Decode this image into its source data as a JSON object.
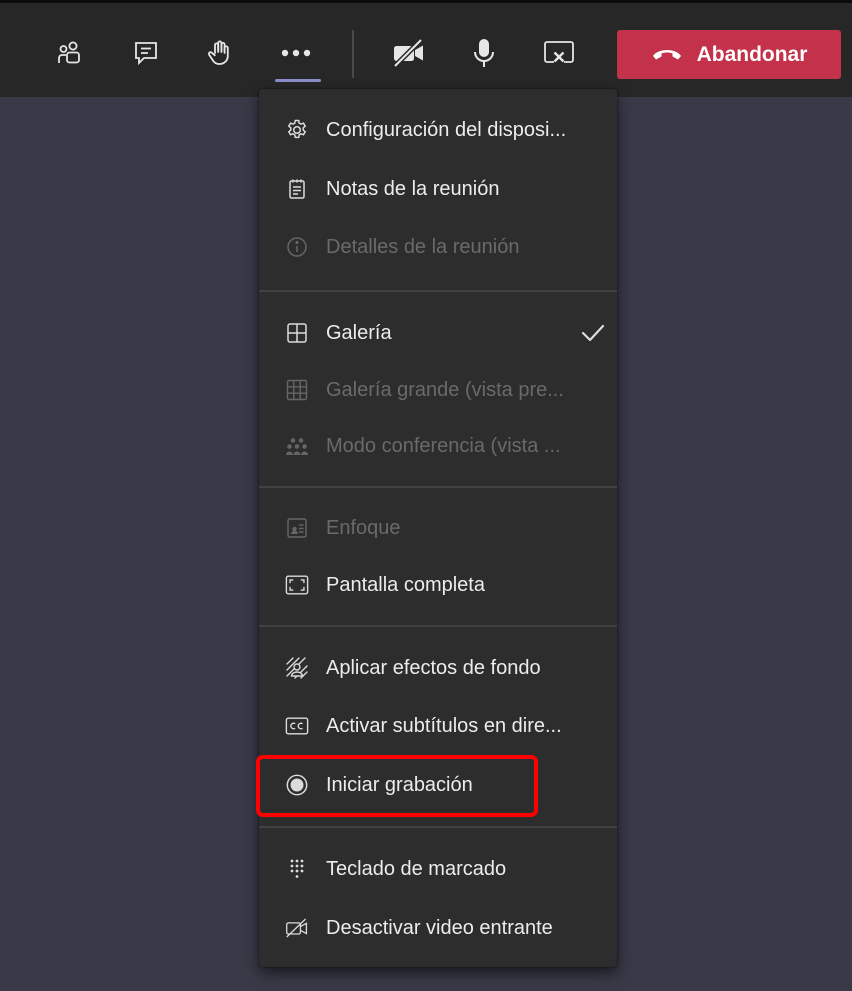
{
  "toolbar": {
    "buttons": [
      {
        "name": "participants",
        "icon": "people-icon"
      },
      {
        "name": "chat",
        "icon": "chat-icon"
      },
      {
        "name": "raise-hand",
        "icon": "hand-icon"
      },
      {
        "name": "more-actions",
        "icon": "more-icon"
      },
      {
        "name": "camera",
        "icon": "camera-off-icon"
      },
      {
        "name": "microphone",
        "icon": "microphone-icon"
      },
      {
        "name": "share",
        "icon": "stop-share-icon"
      }
    ],
    "leave_label": "Abandonar",
    "leave_color": "#c4314b",
    "accent_color": "#8b8dc9"
  },
  "menu": {
    "items": [
      {
        "label": "Configuración del disposi...",
        "icon": "gear-icon",
        "enabled": true
      },
      {
        "label": "Notas de la reunión",
        "icon": "notes-icon",
        "enabled": true
      },
      {
        "label": "Detalles de la reunión",
        "icon": "info-icon",
        "enabled": false
      },
      {
        "label": "Galería",
        "icon": "gallery-icon",
        "enabled": true,
        "checked": true
      },
      {
        "label": "Galería grande (vista pre...",
        "icon": "large-gallery-icon",
        "enabled": false
      },
      {
        "label": "Modo conferencia (vista ...",
        "icon": "together-mode-icon",
        "enabled": false
      },
      {
        "label": "Enfoque",
        "icon": "focus-icon",
        "enabled": false
      },
      {
        "label": "Pantalla completa",
        "icon": "fullscreen-icon",
        "enabled": true
      },
      {
        "label": "Aplicar efectos de fondo",
        "icon": "background-effects-icon",
        "enabled": true
      },
      {
        "label": "Activar subtítulos en dire...",
        "icon": "captions-icon",
        "enabled": true
      },
      {
        "label": "Iniciar grabación",
        "icon": "record-icon",
        "enabled": true,
        "highlighted": true
      },
      {
        "label": "Teclado de marcado",
        "icon": "dialpad-icon",
        "enabled": true
      },
      {
        "label": "Desactivar video entrante",
        "icon": "video-off-icon",
        "enabled": true
      }
    ]
  },
  "colors": {
    "stage_background": "#393947",
    "toolbar_background": "#272727",
    "menu_background": "#2d2d2d",
    "highlight_border": "#ff0000"
  }
}
